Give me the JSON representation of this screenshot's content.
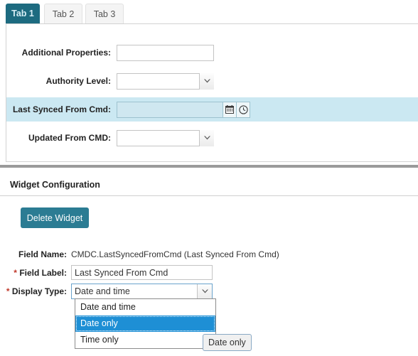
{
  "tabs": [
    {
      "label": "Tab 1",
      "active": true
    },
    {
      "label": "Tab 2",
      "active": false
    },
    {
      "label": "Tab 3",
      "active": false
    }
  ],
  "form": {
    "rows": [
      {
        "label": "Additional Properties:",
        "value": "",
        "control": "text"
      },
      {
        "label": "Authority Level:",
        "value": "",
        "control": "select"
      },
      {
        "label": "Last Synced From Cmd:",
        "value": "",
        "control": "datetime",
        "highlighted": true
      },
      {
        "label": "Updated From CMD:",
        "value": "",
        "control": "select"
      }
    ],
    "datetime_icons": {
      "calendar": "calendar-icon",
      "clock": "clock-icon"
    }
  },
  "widget_config": {
    "title": "Widget Configuration",
    "delete_button": "Delete Widget",
    "field_name_label": "Field Name:",
    "field_name_value": "CMDC.LastSyncedFromCmd (Last Synced From Cmd)",
    "field_label_label": "Field Label:",
    "field_label_value": "Last Synced From Cmd",
    "display_type_label": "Display Type:",
    "display_type_value": "Date and time",
    "required_marker": "*",
    "display_type_options": [
      {
        "label": "Date and time",
        "selected": false
      },
      {
        "label": "Date only",
        "selected": true
      },
      {
        "label": "Time only",
        "selected": false
      }
    ]
  },
  "tooltip": {
    "text": "Date only"
  },
  "colors": {
    "tab_active_bg": "#1d6b80",
    "tab_active_text": "#d7eef5",
    "row_highlight_bg": "#cbe8f2",
    "button_teal": "#2b7c93",
    "option_selected_bg": "#1e8fd5",
    "required_asterisk": "#c0392b"
  }
}
